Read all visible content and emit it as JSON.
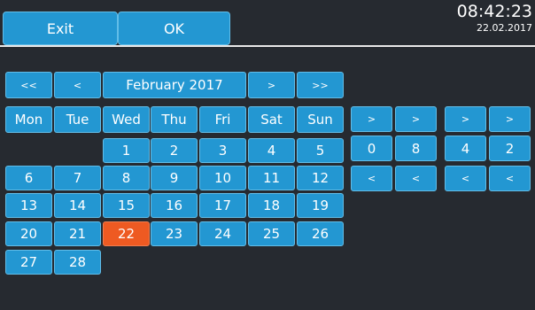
{
  "toolbar": {
    "exit_label": "Exit",
    "ok_label": "OK"
  },
  "clock": {
    "time": "08:42:23",
    "date": "22.02.2017"
  },
  "calendar": {
    "nav": {
      "prev_year": "<<",
      "prev_month": "<",
      "month_label": "February 2017",
      "next_month": ">",
      "next_year": ">>"
    },
    "weekdays": [
      "Mon",
      "Tue",
      "Wed",
      "Thu",
      "Fri",
      "Sat",
      "Sun"
    ],
    "days": [
      "1",
      "2",
      "3",
      "4",
      "5",
      "6",
      "7",
      "8",
      "9",
      "10",
      "11",
      "12",
      "13",
      "14",
      "15",
      "16",
      "17",
      "18",
      "19",
      "20",
      "21",
      "22",
      "23",
      "24",
      "25",
      "26",
      "27",
      "28"
    ],
    "selected_day": "22"
  },
  "time_setter": {
    "up_labels": [
      ">",
      ">",
      ">",
      ">"
    ],
    "digits": [
      "0",
      "8",
      "4",
      "2"
    ],
    "down_labels": [
      "<",
      "<",
      "<",
      "<"
    ]
  },
  "colors": {
    "button": "#2397d2",
    "selected": "#ee5a22",
    "background": "#262a30"
  }
}
